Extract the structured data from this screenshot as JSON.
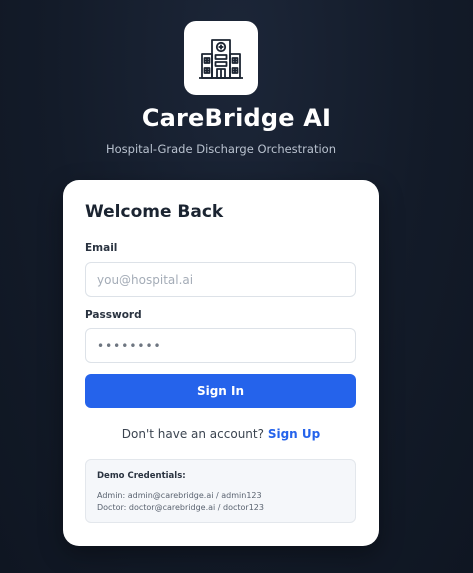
{
  "brand": {
    "icon": "hospital-building-icon",
    "title": "CareBridge AI",
    "subtitle": "Hospital-Grade Discharge Orchestration"
  },
  "login": {
    "heading": "Welcome Back",
    "email_label": "Email",
    "email_placeholder": "you@hospital.ai",
    "email_value": "",
    "password_label": "Password",
    "password_value": "••••••••",
    "submit_label": "Sign In",
    "signup_prompt": "Don't have an account?",
    "signup_link": "Sign Up"
  },
  "demo": {
    "title": "Demo Credentials:",
    "lines": [
      "Admin: admin@carebridge.ai / admin123",
      "Doctor: doctor@carebridge.ai / doctor123"
    ]
  },
  "colors": {
    "accent": "#2563eb",
    "background": "#131b29",
    "card": "#ffffff"
  }
}
